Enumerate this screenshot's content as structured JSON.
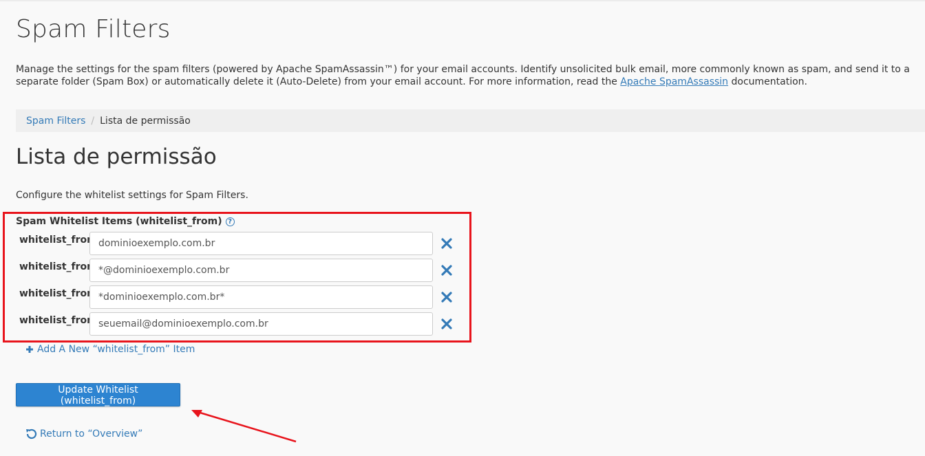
{
  "page": {
    "title": "Spam Filters",
    "intro_text": "Manage the settings for the spam filters (powered by Apache SpamAssassin™) for your email accounts. Identify unsolicited bulk email, more commonly known as spam, and send it to a separate folder (Spam Box) or automatically delete it (Auto-Delete) from your email account. For more information, read the ",
    "intro_link": "Apache SpamAssassin",
    "intro_suffix": " documentation."
  },
  "breadcrumb": {
    "parent": "Spam Filters",
    "separator": "/",
    "current": "Lista de permissão"
  },
  "section": {
    "title": "Lista de permissão",
    "description": "Configure the whitelist settings for Spam Filters.",
    "items_label": "Spam Whitelist Items (whitelist_from)",
    "help_icon": "?"
  },
  "whitelist": [
    {
      "label": "whitelist_from",
      "value": "dominioexemplo.com.br"
    },
    {
      "label": "whitelist_from",
      "value": "*@dominioexemplo.com.br"
    },
    {
      "label": "whitelist_from",
      "value": "*dominioexemplo.com.br*"
    },
    {
      "label": "whitelist_from",
      "value": "seuemail@dominioexemplo.com.br"
    }
  ],
  "actions": {
    "add_label": "Add A New “whitelist_from” Item",
    "update_label": "Update Whitelist (whitelist_from)",
    "return_label": "Return to “Overview”"
  },
  "icons": {
    "remove": "close-icon",
    "add": "plus-icon",
    "return": "undo-icon",
    "help": "question-circle-icon"
  },
  "colors": {
    "link": "#337ab7",
    "primary_button": "#2d84d1",
    "annotation": "#e8141c",
    "remove_icon": "#337ab7"
  }
}
